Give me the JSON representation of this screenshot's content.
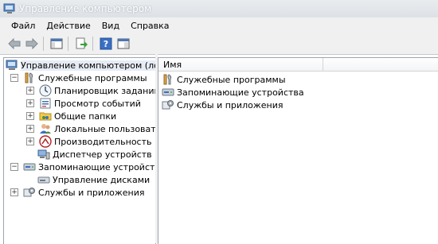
{
  "window": {
    "title": "Управление компьютером"
  },
  "menu": [
    "Файл",
    "Действие",
    "Вид",
    "Справка"
  ],
  "toolbar": {
    "buttons": [
      "back-icon",
      "forward-icon",
      "show-tree-icon",
      "export-icon",
      "help-icon",
      "properties-icon"
    ]
  },
  "tree": {
    "root": "Управление компьютером (лока",
    "system_tools": "Служебные программы",
    "task_scheduler": "Планировщик заданий",
    "event_viewer": "Просмотр событий",
    "shared_folders": "Общие папки",
    "local_users": "Локальные пользовател",
    "performance": "Производительность",
    "device_manager": "Диспетчер устройств",
    "storage": "Запоминающие устройства",
    "disk_management": "Управление дисками",
    "services": "Службы и приложения"
  },
  "list": {
    "column_name": "Имя",
    "items": [
      "Служебные программы",
      "Запоминающие устройства",
      "Службы и приложения"
    ]
  }
}
